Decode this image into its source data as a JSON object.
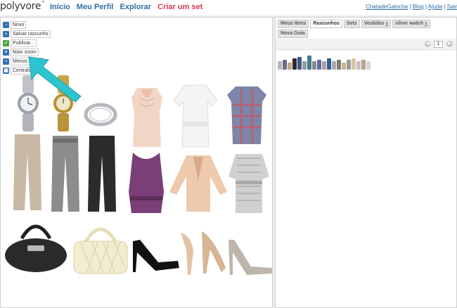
{
  "header": {
    "logo": "polyvore",
    "logo_mark": "™",
    "nav": [
      "Início",
      "Meu Perfil",
      "Explorar",
      "Criar um set"
    ],
    "user_links": {
      "user": "ChatadeGalocha",
      "blog": "Blog",
      "help": "Ajuda",
      "logout": "Sair",
      "sep": " | "
    }
  },
  "editor_menu": [
    {
      "label": "Novo",
      "icon": "new-doc-icon",
      "color": "#3b6fb6"
    },
    {
      "label": "Salvar rascunho",
      "icon": "save-disk-icon",
      "color": "#3b6fb6"
    },
    {
      "label": "Publicar...",
      "icon": "publish-check-icon",
      "color": "#4aa33f"
    },
    {
      "label": "Mais zoom",
      "icon": "zoom-in-icon",
      "color": "#3b6fb6"
    },
    {
      "label": "Menos zoom",
      "icon": "zoom-out-icon",
      "color": "#3b6fb6"
    },
    {
      "label": "Centralizar",
      "icon": "center-icon",
      "color": "#3b6fb6"
    }
  ],
  "right_panel": {
    "tabs": [
      {
        "label": "Meus Itens",
        "closable": false
      },
      {
        "label": "Rascunhos",
        "closable": false,
        "active": true
      },
      {
        "label": "Sets",
        "closable": false
      },
      {
        "label": "Vestidos",
        "closable": true
      },
      {
        "label": "silver watch",
        "closable": true
      },
      {
        "label": "Nova Guia",
        "closable": false
      }
    ],
    "close_mark": "x",
    "page_number": "1"
  },
  "colors": {
    "accent_blue": "#2f6ca8",
    "create_pink": "#d23a5b",
    "arrow_teal": "#2ec4cf"
  }
}
